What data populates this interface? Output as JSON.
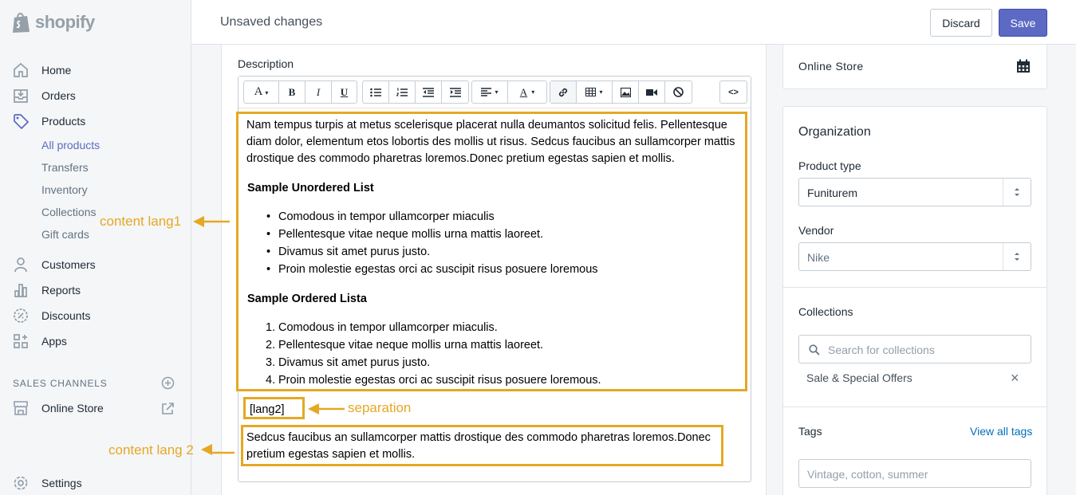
{
  "brand": {
    "name": "shopify"
  },
  "topbar": {
    "title": "Unsaved changes",
    "discard_label": "Discard",
    "save_label": "Save"
  },
  "sidebar": {
    "items": [
      {
        "label": "Home",
        "icon": "home-icon"
      },
      {
        "label": "Orders",
        "icon": "orders-icon"
      },
      {
        "label": "Products",
        "icon": "tag-icon"
      },
      {
        "label": "Customers",
        "icon": "person-icon"
      },
      {
        "label": "Reports",
        "icon": "bar-chart-icon"
      },
      {
        "label": "Discounts",
        "icon": "discount-icon"
      },
      {
        "label": "Apps",
        "icon": "apps-icon"
      }
    ],
    "product_subitems": [
      "All products",
      "Transfers",
      "Inventory",
      "Collections",
      "Gift cards"
    ],
    "sales_channels_title": "SALES CHANNELS",
    "online_store": "Online Store",
    "settings": "Settings"
  },
  "editor": {
    "label": "Description",
    "paragraph1": "Nam tempus turpis at metus scelerisque placerat nulla deumantos solicitud felis. Pellentesque diam dolor, elementum etos lobortis des mollis ut risus. Sedcus faucibus an sullamcorper mattis drostique des commodo pharetras loremos.Donec pretium egestas sapien et mollis.",
    "unordered_heading": "Sample Unordered List",
    "unordered_items": [
      "Comodous in tempor ullamcorper miaculis",
      "Pellentesque vitae neque mollis urna mattis laoreet.",
      "Divamus sit amet purus justo.",
      "Proin molestie egestas orci ac suscipit risus posuere loremous"
    ],
    "ordered_heading": "Sample Ordered Lista",
    "ordered_items": [
      "Comodous in tempor ullamcorper miaculis.",
      "Pellentesque vitae neque mollis urna mattis laoreet.",
      "Divamus sit amet purus justo.",
      "Proin molestie egestas orci ac suscipit risus posuere loremous."
    ],
    "separator": "[lang2]",
    "paragraph2": "Sedcus faucibus an sullamcorper mattis drostique des commodo pharetras loremos.Donec pretium egestas sapien et mollis.",
    "toolbar": {
      "font_label": "A",
      "bold": "B",
      "italic": "I",
      "underline": "U",
      "code": "<>"
    }
  },
  "annotations": {
    "content_lang1": "content lang1",
    "separation": "separation",
    "content_lang2": "content lang 2",
    "color": "#e5a823"
  },
  "right": {
    "visibility_channel": "Online Store",
    "organization_title": "Organization",
    "product_type_label": "Product type",
    "product_type_value": "Funiturem",
    "vendor_label": "Vendor",
    "vendor_value": "Nike",
    "collections_label": "Collections",
    "collections_search_placeholder": "Search for collections",
    "collections_items": [
      "Sale & Special Offers"
    ],
    "tags_label": "Tags",
    "view_all_tags": "View all tags",
    "tags_placeholder": "Vintage, cotton, summer"
  },
  "colors": {
    "accent": "#5c6ac4",
    "link": "#006fbb",
    "annotation": "#e5a823"
  }
}
